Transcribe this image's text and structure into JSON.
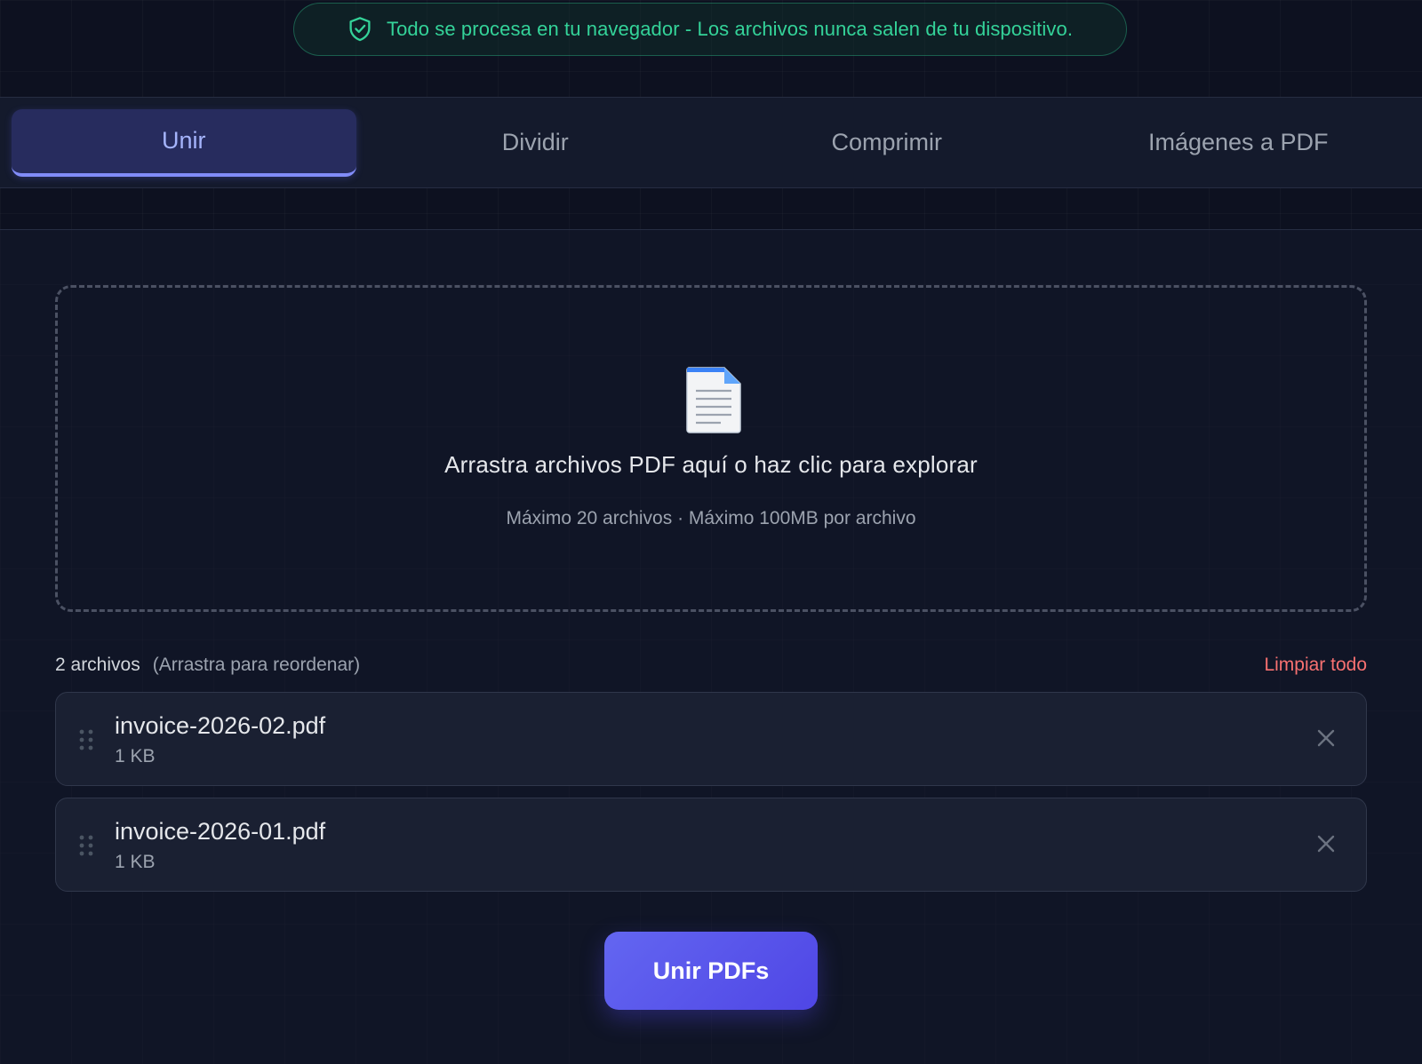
{
  "privacy_banner": {
    "icon": "shield-check-icon",
    "text": "Todo se procesa en tu navegador - Los archivos nunca salen de tu dispositivo."
  },
  "tabs": [
    {
      "label": "Unir",
      "active": true
    },
    {
      "label": "Dividir",
      "active": false
    },
    {
      "label": "Comprimir",
      "active": false
    },
    {
      "label": "Imágenes a PDF",
      "active": false
    }
  ],
  "dropzone": {
    "icon": "document-icon",
    "title": "Arrastra archivos PDF aquí o haz clic para explorar",
    "subtitle": "Máximo 20 archivos · Máximo 100MB por archivo"
  },
  "file_list": {
    "count_label": "2 archivos",
    "hint": "(Arrastra para reordenar)",
    "clear_label": "Limpiar todo",
    "files": [
      {
        "name": "invoice-2026-02.pdf",
        "size": "1 KB"
      },
      {
        "name": "invoice-2026-01.pdf",
        "size": "1 KB"
      }
    ]
  },
  "action": {
    "label": "Unir PDFs"
  },
  "colors": {
    "accent": "#6366f1",
    "success": "#34d399",
    "danger": "#f87171",
    "background": "#0d1120"
  }
}
